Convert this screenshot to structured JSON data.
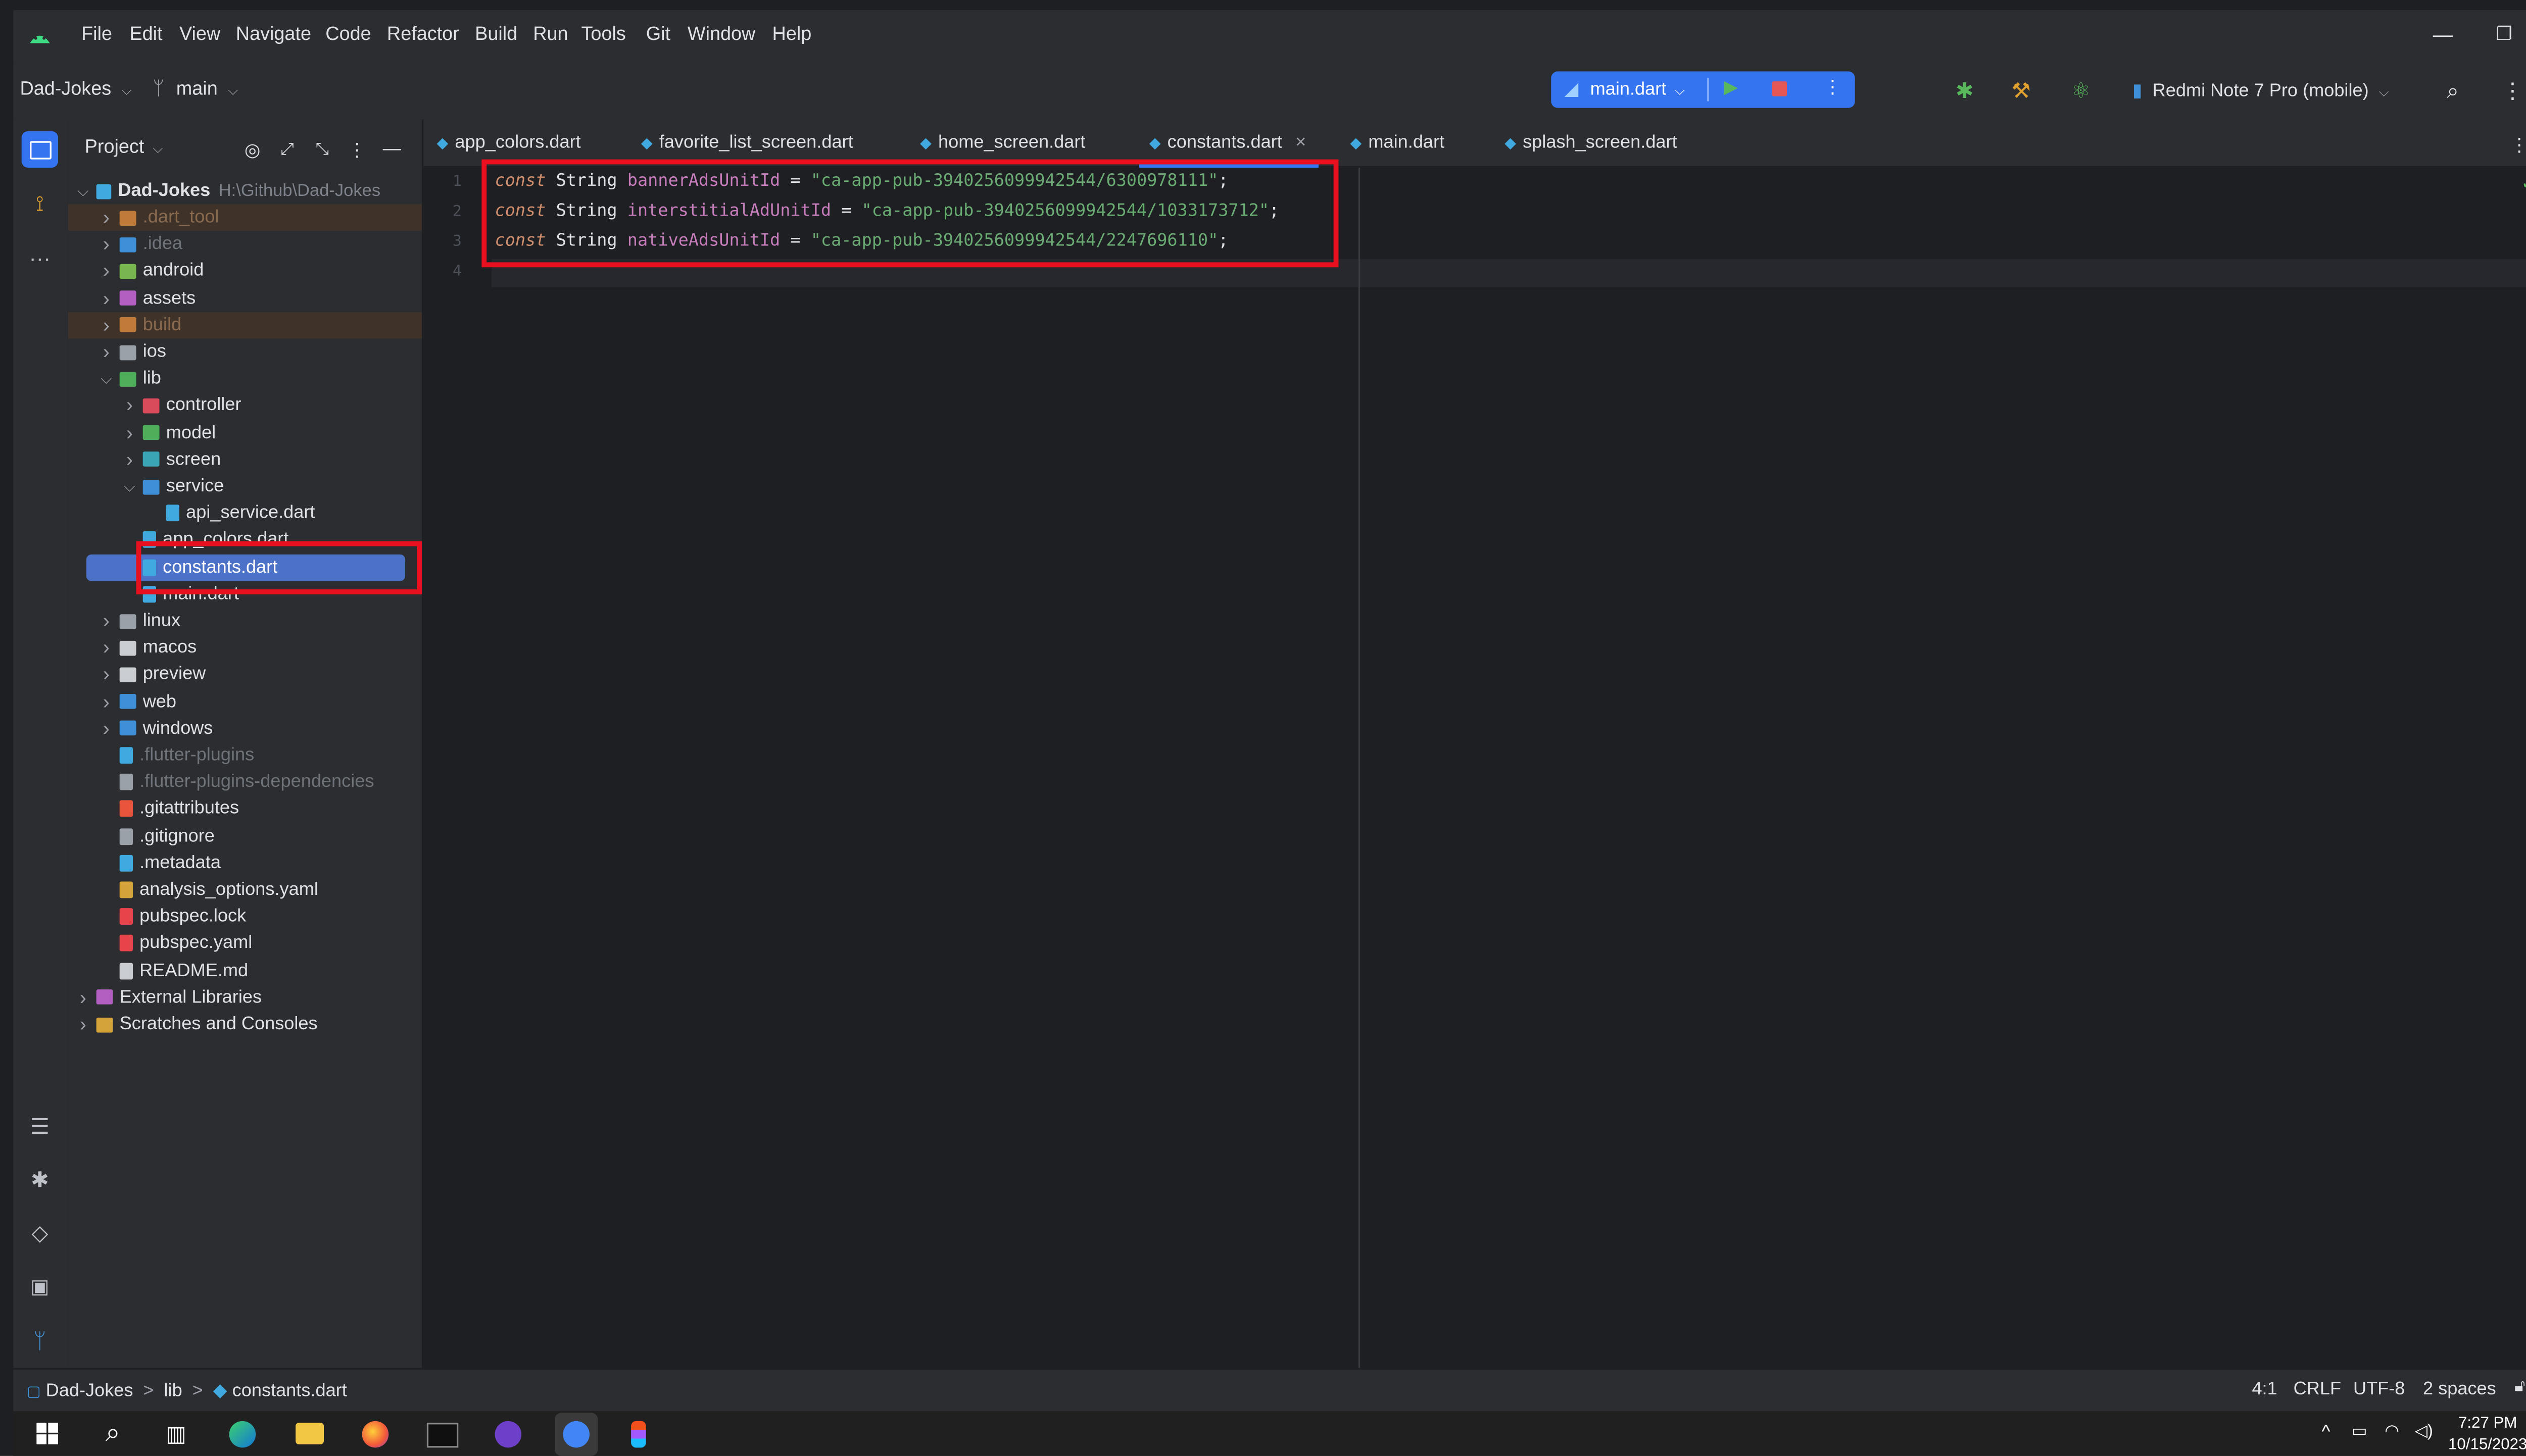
{
  "menubar": {
    "items": [
      "File",
      "Edit",
      "View",
      "Navigate",
      "Code",
      "Refactor",
      "Build",
      "Run",
      "Tools",
      "Git",
      "Window",
      "Help"
    ]
  },
  "toolbar": {
    "project": "Dad-Jokes",
    "branch": "main",
    "run_config": "main.dart",
    "device": "Redmi Note 7 Pro (mobile)"
  },
  "project_panel": {
    "title": "Project",
    "root_name": "Dad-Jokes",
    "root_path": "H:\\Github\\Dad-Jokes",
    "tree": [
      {
        "label": ".dart_tool",
        "depth": 1,
        "chev": "right",
        "color": "#c07a3a",
        "muted": true,
        "excluded": true
      },
      {
        "label": ".idea",
        "depth": 1,
        "chev": "right",
        "color": "#3f8fd6",
        "muted": true
      },
      {
        "label": "android",
        "depth": 1,
        "chev": "right",
        "color": "#78b64f"
      },
      {
        "label": "assets",
        "depth": 1,
        "chev": "right",
        "color": "#b35fc1"
      },
      {
        "label": "build",
        "depth": 1,
        "chev": "right",
        "color": "#c07a3a",
        "muted": true,
        "excluded": true
      },
      {
        "label": "ios",
        "depth": 1,
        "chev": "right",
        "color": "#9aa0a8"
      },
      {
        "label": "lib",
        "depth": 1,
        "chev": "down",
        "color": "#4fae5a"
      },
      {
        "label": "controller",
        "depth": 2,
        "chev": "right",
        "color": "#d94a5a"
      },
      {
        "label": "model",
        "depth": 2,
        "chev": "right",
        "color": "#4fae5a"
      },
      {
        "label": "screen",
        "depth": 2,
        "chev": "right",
        "color": "#39a5b5"
      },
      {
        "label": "service",
        "depth": 2,
        "chev": "down",
        "color": "#3f8fd6"
      },
      {
        "label": "api_service.dart",
        "depth": 3,
        "chev": "none",
        "color": "#40a9e0"
      },
      {
        "label": "app_colors.dart",
        "depth": 2,
        "chev": "none",
        "color": "#40a9e0"
      },
      {
        "label": "constants.dart",
        "depth": 2,
        "chev": "none",
        "color": "#40a9e0",
        "selected": true
      },
      {
        "label": "main.dart",
        "depth": 2,
        "chev": "none",
        "color": "#40a9e0"
      },
      {
        "label": "linux",
        "depth": 1,
        "chev": "right",
        "color": "#9aa0a8"
      },
      {
        "label": "macos",
        "depth": 1,
        "chev": "right",
        "color": "#c9ccd1"
      },
      {
        "label": "preview",
        "depth": 1,
        "chev": "right",
        "color": "#c9ccd1"
      },
      {
        "label": "web",
        "depth": 1,
        "chev": "right",
        "color": "#3f8fd6"
      },
      {
        "label": "windows",
        "depth": 1,
        "chev": "right",
        "color": "#3f8fd6"
      },
      {
        "label": ".flutter-plugins",
        "depth": 1,
        "chev": "none",
        "color": "#40a9e0",
        "muted": true
      },
      {
        "label": ".flutter-plugins-dependencies",
        "depth": 1,
        "chev": "none",
        "color": "#9aa0a8",
        "muted": true
      },
      {
        "label": ".gitattributes",
        "depth": 1,
        "chev": "none",
        "color": "#e8543c"
      },
      {
        "label": ".gitignore",
        "depth": 1,
        "chev": "none",
        "color": "#9aa0a8"
      },
      {
        "label": ".metadata",
        "depth": 1,
        "chev": "none",
        "color": "#40a9e0"
      },
      {
        "label": "analysis_options.yaml",
        "depth": 1,
        "chev": "none",
        "color": "#d4a43a"
      },
      {
        "label": "pubspec.lock",
        "depth": 1,
        "chev": "none",
        "color": "#e8434a"
      },
      {
        "label": "pubspec.yaml",
        "depth": 1,
        "chev": "none",
        "color": "#e8434a"
      },
      {
        "label": "README.md",
        "depth": 1,
        "chev": "none",
        "color": "#c9ccd1"
      },
      {
        "label": "External Libraries",
        "depth": 0,
        "chev": "right",
        "color": "#b35fc1"
      },
      {
        "label": "Scratches and Consoles",
        "depth": 0,
        "chev": "right",
        "color": "#d4a43a"
      }
    ]
  },
  "editor": {
    "tabs": [
      {
        "label": "app_colors.dart"
      },
      {
        "label": "favorite_list_screen.dart"
      },
      {
        "label": "home_screen.dart"
      },
      {
        "label": "constants.dart",
        "active": true,
        "close": "×"
      },
      {
        "label": "main.dart"
      },
      {
        "label": "splash_screen.dart"
      }
    ],
    "line_numbers": [
      "1",
      "2",
      "3",
      "4"
    ],
    "lines": [
      {
        "keyword": "const",
        "type": "String",
        "name": "bannerAdsUnitId",
        "op": " = ",
        "value": "\"ca-app-pub-3940256099942544/6300978111\"",
        "end": ";"
      },
      {
        "keyword": "const",
        "type": "String",
        "name": "interstitialAdUnitId",
        "op": " = ",
        "value": "\"ca-app-pub-3940256099942544/1033173712\"",
        "end": ";"
      },
      {
        "keyword": "const",
        "type": "String",
        "name": "nativeAdsUnitId",
        "op": " = ",
        "value": "\"ca-app-pub-3940256099942544/2247696110\"",
        "end": ";"
      }
    ]
  },
  "statusbar": {
    "breadcrumb": [
      "Dad-Jokes",
      "lib",
      "constants.dart"
    ],
    "sep": ">",
    "position": "4:1",
    "line_ending": "CRLF",
    "encoding": "UTF-8",
    "indent": "2 spaces"
  },
  "taskbar": {
    "time": "7:27 PM",
    "date": "10/15/2023"
  },
  "colors": {
    "keyword": "#cf8e6d",
    "type": "#dfe1e5",
    "constant": "#c77dbb",
    "string": "#6aab73",
    "highlight": "#e8101e",
    "selection": "#2e436e"
  }
}
